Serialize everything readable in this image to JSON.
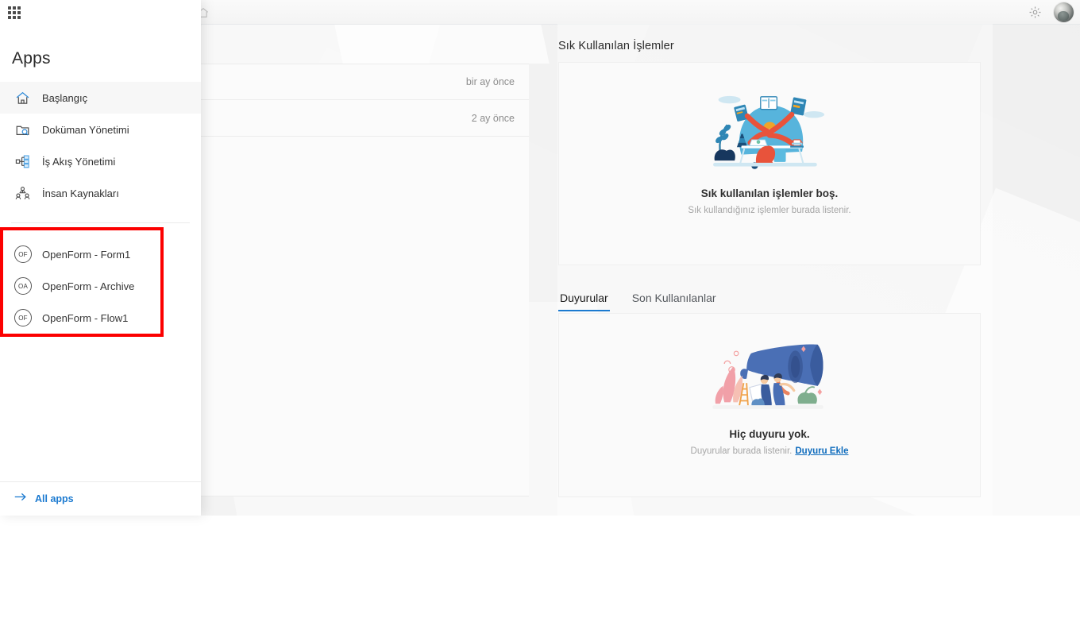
{
  "topbar": {
    "gear_icon": "gear-icon",
    "avatar_icon": "user-avatar"
  },
  "background": {
    "home_icon": "home-icon",
    "rows": [
      {
        "time": "bir ay önce"
      },
      {
        "time": "2 ay önce"
      }
    ]
  },
  "flyout": {
    "waffle_icon": "app-launcher-waffle-icon",
    "title": "Apps",
    "nav_items": [
      {
        "label": "Başlangıç",
        "icon": "home-icon",
        "selected": true
      },
      {
        "label": "Doküman Yönetimi",
        "icon": "folder-search-icon",
        "selected": false
      },
      {
        "label": "İş Akış Yönetimi",
        "icon": "workflow-icon",
        "selected": false
      },
      {
        "label": "İnsan Kaynakları",
        "icon": "people-icon",
        "selected": false
      }
    ],
    "apps": [
      {
        "initials": "OF",
        "label": "OpenForm - Form1"
      },
      {
        "initials": "OA",
        "label": "OpenForm - Archive"
      },
      {
        "initials": "OF",
        "label": "OpenForm - Flow1"
      }
    ],
    "footer": {
      "arrow_icon": "arrow-right-icon",
      "label": "All apps"
    },
    "highlight_color": "#fc0000"
  },
  "content": {
    "frequent": {
      "title": "Sık Kullanılan İşlemler",
      "illustration": "person-at-desk-illustration",
      "empty_title": "Sık kullanılan işlemler boş.",
      "empty_sub": "Sık kullandığınız işlemler burada listenir."
    },
    "tabs": [
      {
        "label": "Duyurular",
        "active": true
      },
      {
        "label": "Son Kullanılanlar",
        "active": false
      }
    ],
    "announcements": {
      "illustration": "megaphone-illustration",
      "empty_title": "Hiç duyuru yok.",
      "empty_sub": "Duyurular burada listenir.",
      "empty_link": "Duyuru Ekle"
    }
  },
  "colors": {
    "accent_blue": "#1b7ad0",
    "link_blue": "#0f6cbd",
    "highlight_red": "#fc0000"
  }
}
